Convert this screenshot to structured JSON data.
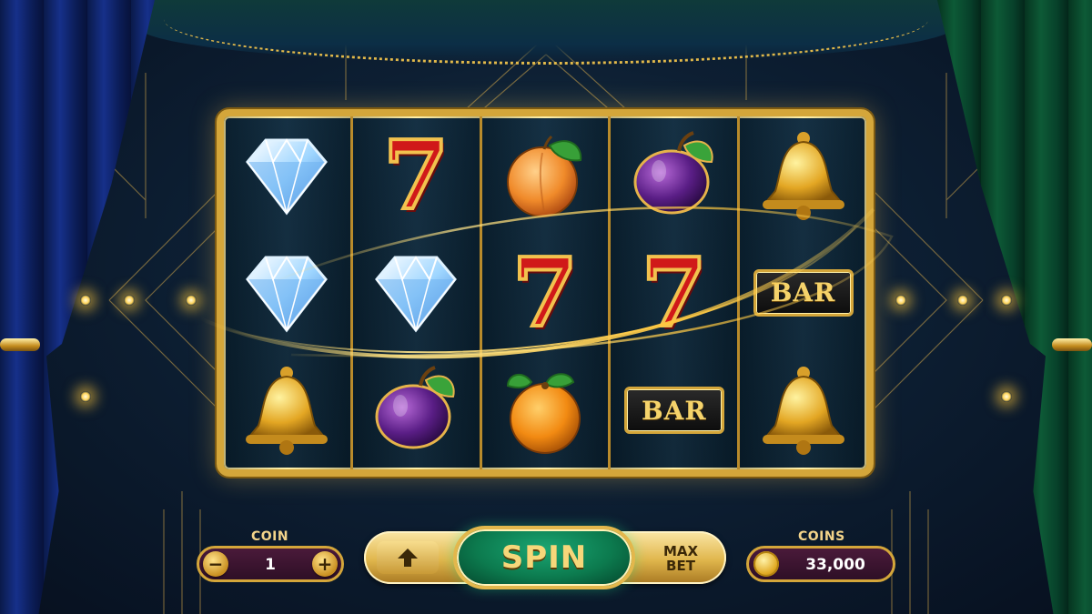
{
  "reels": [
    [
      "diamond",
      "diamond",
      "bell"
    ],
    [
      "seven",
      "diamond",
      "plum"
    ],
    [
      "peach",
      "seven",
      "orange"
    ],
    [
      "plum",
      "seven",
      "bar"
    ],
    [
      "bell",
      "bar",
      "bell"
    ]
  ],
  "symbols": {
    "seven_text": "7",
    "bar_text": "BAR"
  },
  "controls": {
    "coin_label": "COIN",
    "coin_value": "1",
    "minus": "−",
    "plus": "+",
    "spin_label": "SPIN",
    "max_label": "MAX",
    "bet_label": "BET",
    "coins_label": "COINS",
    "coins_value": "33,000"
  },
  "colors": {
    "gold": "#d4a63a",
    "spin_green": "#0c7a4e",
    "curtain_left": "#16308a",
    "curtain_right": "#0d5a36"
  },
  "icons": {
    "up": "arrow-up-icon",
    "coin": "coin-icon"
  }
}
